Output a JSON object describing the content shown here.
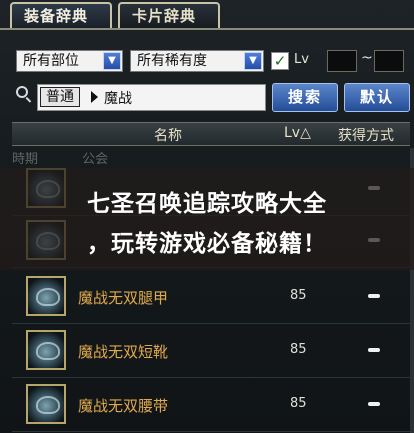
{
  "tabs": [
    {
      "label": "装备辞典",
      "active": true
    },
    {
      "label": "卡片辞典",
      "active": false
    }
  ],
  "filters": {
    "slot": "所有部位",
    "rarity": "所有稀有度",
    "lv_checked": true,
    "lv_label": "Lv",
    "lv_min": "",
    "lv_max": ""
  },
  "search": {
    "mode": "普通",
    "query": "魔战",
    "search_label": "搜索",
    "default_label": "默认"
  },
  "table": {
    "columns": {
      "name": "名称",
      "lv": "Lv△",
      "source": "获得方式"
    },
    "subheader": [
      "時期",
      "公会"
    ],
    "rows": [
      {
        "name": "",
        "lv": "",
        "source": "−"
      },
      {
        "name": "",
        "lv": "",
        "source": "−"
      },
      {
        "name": "魔战无双腿甲",
        "lv": "85",
        "source": "−"
      },
      {
        "name": "魔战无双短靴",
        "lv": "85",
        "source": "−"
      },
      {
        "name": "魔战无双腰带",
        "lv": "85",
        "source": "−"
      }
    ]
  },
  "overlay": {
    "line1": "七圣召唤追踪攻略大全",
    "line2": "，玩转游戏必备秘籍！"
  },
  "colors": {
    "item_name": "#e0aa4c",
    "button": "#2f5aa8"
  }
}
